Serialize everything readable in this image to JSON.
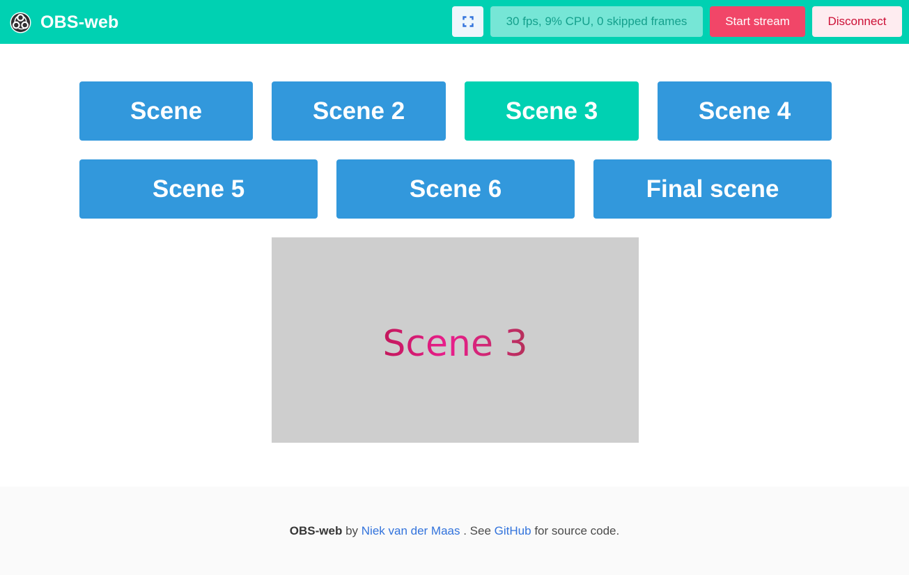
{
  "header": {
    "title": "OBS-web",
    "stats": "30 fps, 9% CPU, 0 skipped frames",
    "start_stream_label": "Start stream",
    "disconnect_label": "Disconnect"
  },
  "scenes": [
    {
      "label": "Scene",
      "active": false
    },
    {
      "label": "Scene 2",
      "active": false
    },
    {
      "label": "Scene 3",
      "active": true
    },
    {
      "label": "Scene 4",
      "active": false
    },
    {
      "label": "Scene 5",
      "active": false
    },
    {
      "label": "Scene 6",
      "active": false
    },
    {
      "label": "Final scene",
      "active": false
    }
  ],
  "preview": {
    "text": "Scene 3"
  },
  "footer": {
    "app_name": "OBS-web",
    "by": "by",
    "author_link": "Niek van der Maas",
    "see": ". See",
    "github_link": "GitHub",
    "suffix": "for source code."
  },
  "colors": {
    "brand": "#00d1b2",
    "scene_button": "#3298dc",
    "scene_active": "#00d1b2",
    "danger": "#f14668",
    "link": "#3273dc"
  },
  "icons": {
    "logo": "obs-logo-icon",
    "fullscreen": "fullscreen-icon"
  }
}
